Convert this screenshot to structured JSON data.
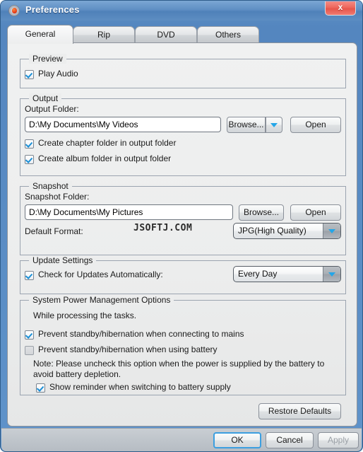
{
  "window": {
    "title": "Preferences",
    "icon": "disc-icon",
    "close_label": "x",
    "accent_color": "#5f8fc4",
    "close_color": "#ef6a60"
  },
  "tabs": [
    {
      "label": "General",
      "active": true
    },
    {
      "label": "Rip",
      "active": false
    },
    {
      "label": "DVD",
      "active": false
    },
    {
      "label": "Others",
      "active": false
    }
  ],
  "preview": {
    "title": "Preview",
    "play_audio": {
      "label": "Play Audio",
      "checked": true
    }
  },
  "output": {
    "title": "Output",
    "folder_label": "Output Folder:",
    "folder_value": "D:\\My Documents\\My Videos",
    "browse_label": "Browse...",
    "open_label": "Open",
    "chapter_folder": {
      "label": "Create chapter folder in output folder",
      "checked": true
    },
    "album_folder": {
      "label": "Create album folder in output folder",
      "checked": true
    }
  },
  "snapshot": {
    "title": "Snapshot",
    "folder_label": "Snapshot Folder:",
    "folder_value": "D:\\My Documents\\My Pictures",
    "browse_label": "Browse...",
    "open_label": "Open",
    "format_label": "Default Format:",
    "format_value": "JPG(High Quality)"
  },
  "update": {
    "title": "Update Settings",
    "check_label": "Check for Updates Automatically:",
    "check_checked": true,
    "frequency_value": "Every Day"
  },
  "power": {
    "title": "System Power Management Options",
    "intro": "While processing the tasks.",
    "mains": {
      "label": "Prevent standby/hibernation when connecting to mains",
      "checked": true
    },
    "battery": {
      "label": "Prevent standby/hibernation when using battery",
      "checked": false
    },
    "note": "Note: Please uncheck this option when the power is supplied by the battery to avoid battery depletion.",
    "reminder": {
      "label": "Show reminder when switching to battery supply",
      "checked": true
    }
  },
  "actions": {
    "restore_defaults": "Restore Defaults",
    "ok": "OK",
    "cancel": "Cancel",
    "apply": "Apply"
  },
  "watermark": "JSOFTJ.COM"
}
